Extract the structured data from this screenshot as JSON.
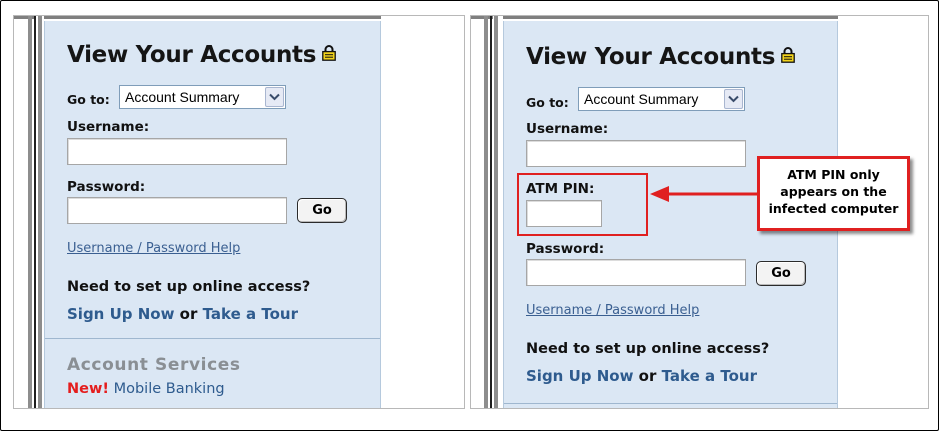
{
  "left_screen": {
    "title": "View Your Accounts",
    "goto_label": "Go to:",
    "goto_selected": "Account Summary",
    "username_label": "Username:",
    "password_label": "Password:",
    "go_button_label": "Go",
    "help_link": "Username / Password Help",
    "need_text": "Need to set up online access?",
    "signup_link": "Sign Up Now",
    "or_text": " or ",
    "tour_link": "Take a Tour",
    "services_heading": "Account Services",
    "new_badge": "New!",
    "mobile_link": "Mobile Banking"
  },
  "right_screen": {
    "title": "View Your Accounts",
    "goto_label": "Go to:",
    "goto_selected": "Account Summary",
    "username_label": "Username:",
    "atm_label": "ATM PIN:",
    "password_label": "Password:",
    "go_button_label": "Go",
    "help_link": "Username / Password Help",
    "need_text": "Need to set up online access?",
    "signup_link": "Sign Up Now",
    "or_text": " or ",
    "tour_link": "Take a Tour"
  },
  "callout": {
    "lines": [
      "ATM PIN only",
      "appears on the",
      "infected computer"
    ]
  },
  "icons": {
    "lock": "lock-icon",
    "dropdown": "chevron-down-icon"
  },
  "colors": {
    "panel_bg": "#dbe7f4",
    "link": "#2e5b8e",
    "highlight_red": "#e02020",
    "new_badge": "#e41d1d",
    "lock_yellow": "#f2d31c"
  }
}
